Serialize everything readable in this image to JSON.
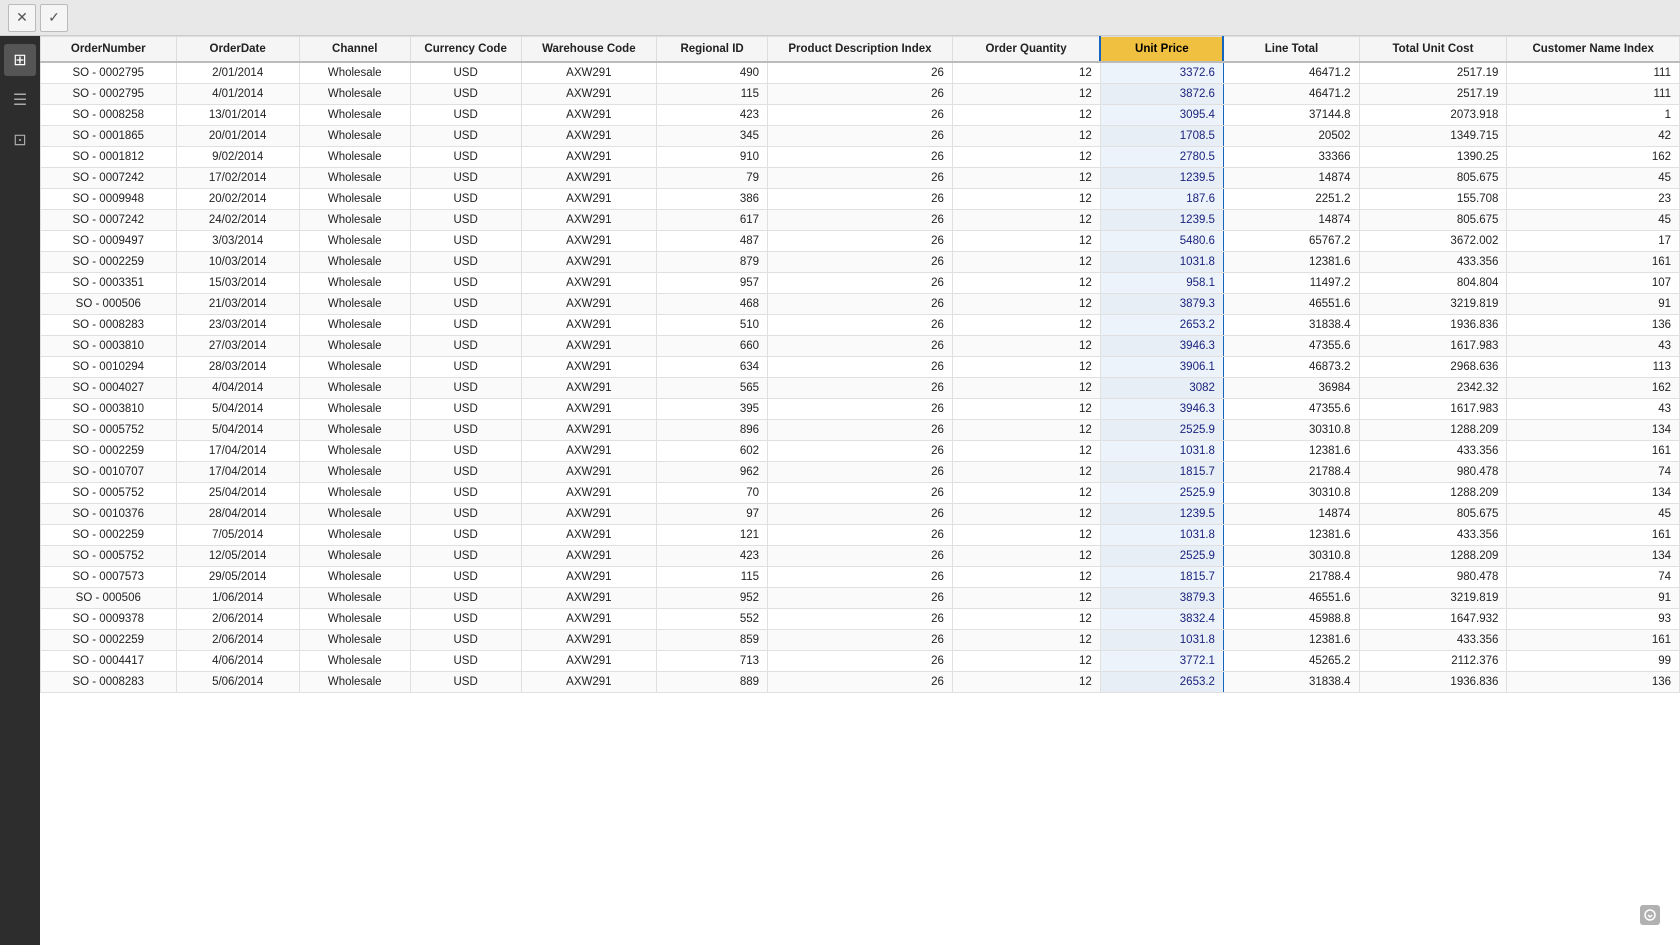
{
  "toolbar": {
    "close_label": "✕",
    "confirm_label": "✓"
  },
  "sidebar": {
    "items": [
      {
        "label": "⊞",
        "name": "grid-icon"
      },
      {
        "label": "≡",
        "name": "list-icon"
      },
      {
        "label": "⊡",
        "name": "table-icon"
      }
    ]
  },
  "table": {
    "columns": [
      {
        "key": "orderNumber",
        "label": "OrderNumber",
        "class": "col-order-number",
        "align": "text-col"
      },
      {
        "key": "orderDate",
        "label": "OrderDate",
        "class": "col-order-date",
        "align": "text-col"
      },
      {
        "key": "channel",
        "label": "Channel",
        "class": "col-channel",
        "align": "text-col"
      },
      {
        "key": "currencyCode",
        "label": "Currency Code",
        "class": "col-currency",
        "align": "text-col"
      },
      {
        "key": "warehouseCode",
        "label": "Warehouse Code",
        "class": "col-warehouse",
        "align": "text-col"
      },
      {
        "key": "regionalId",
        "label": "Regional ID",
        "class": "col-regional",
        "align": ""
      },
      {
        "key": "productDescIndex",
        "label": "Product Description Index",
        "class": "col-product-desc",
        "align": ""
      },
      {
        "key": "orderQuantity",
        "label": "Order Quantity",
        "class": "col-order-qty",
        "align": ""
      },
      {
        "key": "unitPrice",
        "label": "Unit Price",
        "class": "col-unit-price",
        "align": "",
        "sorted": true
      },
      {
        "key": "lineTotal",
        "label": "Line Total",
        "class": "col-line-total",
        "align": ""
      },
      {
        "key": "totalUnitCost",
        "label": "Total Unit Cost",
        "class": "col-total-unit",
        "align": ""
      },
      {
        "key": "customerNameIndex",
        "label": "Customer Name Index",
        "class": "col-customer",
        "align": ""
      }
    ],
    "rows": [
      {
        "orderNumber": "SO - 0002795",
        "orderDate": "2/01/2014",
        "channel": "Wholesale",
        "currencyCode": "USD",
        "warehouseCode": "AXW291",
        "regionalId": "490",
        "productDescIndex": "26",
        "orderQuantity": "12",
        "unitPrice": "3372.6",
        "lineTotal": "46471.2",
        "totalUnitCost": "2517.19",
        "customerNameIndex": "111"
      },
      {
        "orderNumber": "SO - 0002795",
        "orderDate": "4/01/2014",
        "channel": "Wholesale",
        "currencyCode": "USD",
        "warehouseCode": "AXW291",
        "regionalId": "115",
        "productDescIndex": "26",
        "orderQuantity": "12",
        "unitPrice": "3872.6",
        "lineTotal": "46471.2",
        "totalUnitCost": "2517.19",
        "customerNameIndex": "111"
      },
      {
        "orderNumber": "SO - 0008258",
        "orderDate": "13/01/2014",
        "channel": "Wholesale",
        "currencyCode": "USD",
        "warehouseCode": "AXW291",
        "regionalId": "423",
        "productDescIndex": "26",
        "orderQuantity": "12",
        "unitPrice": "3095.4",
        "lineTotal": "37144.8",
        "totalUnitCost": "2073.918",
        "customerNameIndex": "1"
      },
      {
        "orderNumber": "SO - 0001865",
        "orderDate": "20/01/2014",
        "channel": "Wholesale",
        "currencyCode": "USD",
        "warehouseCode": "AXW291",
        "regionalId": "345",
        "productDescIndex": "26",
        "orderQuantity": "12",
        "unitPrice": "1708.5",
        "lineTotal": "20502",
        "totalUnitCost": "1349.715",
        "customerNameIndex": "42"
      },
      {
        "orderNumber": "SO - 0001812",
        "orderDate": "9/02/2014",
        "channel": "Wholesale",
        "currencyCode": "USD",
        "warehouseCode": "AXW291",
        "regionalId": "910",
        "productDescIndex": "26",
        "orderQuantity": "12",
        "unitPrice": "2780.5",
        "lineTotal": "33366",
        "totalUnitCost": "1390.25",
        "customerNameIndex": "162"
      },
      {
        "orderNumber": "SO - 0007242",
        "orderDate": "17/02/2014",
        "channel": "Wholesale",
        "currencyCode": "USD",
        "warehouseCode": "AXW291",
        "regionalId": "79",
        "productDescIndex": "26",
        "orderQuantity": "12",
        "unitPrice": "1239.5",
        "lineTotal": "14874",
        "totalUnitCost": "805.675",
        "customerNameIndex": "45"
      },
      {
        "orderNumber": "SO - 0009948",
        "orderDate": "20/02/2014",
        "channel": "Wholesale",
        "currencyCode": "USD",
        "warehouseCode": "AXW291",
        "regionalId": "386",
        "productDescIndex": "26",
        "orderQuantity": "12",
        "unitPrice": "187.6",
        "lineTotal": "2251.2",
        "totalUnitCost": "155.708",
        "customerNameIndex": "23"
      },
      {
        "orderNumber": "SO - 0007242",
        "orderDate": "24/02/2014",
        "channel": "Wholesale",
        "currencyCode": "USD",
        "warehouseCode": "AXW291",
        "regionalId": "617",
        "productDescIndex": "26",
        "orderQuantity": "12",
        "unitPrice": "1239.5",
        "lineTotal": "14874",
        "totalUnitCost": "805.675",
        "customerNameIndex": "45"
      },
      {
        "orderNumber": "SO - 0009497",
        "orderDate": "3/03/2014",
        "channel": "Wholesale",
        "currencyCode": "USD",
        "warehouseCode": "AXW291",
        "regionalId": "487",
        "productDescIndex": "26",
        "orderQuantity": "12",
        "unitPrice": "5480.6",
        "lineTotal": "65767.2",
        "totalUnitCost": "3672.002",
        "customerNameIndex": "17"
      },
      {
        "orderNumber": "SO - 0002259",
        "orderDate": "10/03/2014",
        "channel": "Wholesale",
        "currencyCode": "USD",
        "warehouseCode": "AXW291",
        "regionalId": "879",
        "productDescIndex": "26",
        "orderQuantity": "12",
        "unitPrice": "1031.8",
        "lineTotal": "12381.6",
        "totalUnitCost": "433.356",
        "customerNameIndex": "161"
      },
      {
        "orderNumber": "SO - 0003351",
        "orderDate": "15/03/2014",
        "channel": "Wholesale",
        "currencyCode": "USD",
        "warehouseCode": "AXW291",
        "regionalId": "957",
        "productDescIndex": "26",
        "orderQuantity": "12",
        "unitPrice": "958.1",
        "lineTotal": "11497.2",
        "totalUnitCost": "804.804",
        "customerNameIndex": "107"
      },
      {
        "orderNumber": "SO - 000506",
        "orderDate": "21/03/2014",
        "channel": "Wholesale",
        "currencyCode": "USD",
        "warehouseCode": "AXW291",
        "regionalId": "468",
        "productDescIndex": "26",
        "orderQuantity": "12",
        "unitPrice": "3879.3",
        "lineTotal": "46551.6",
        "totalUnitCost": "3219.819",
        "customerNameIndex": "91"
      },
      {
        "orderNumber": "SO - 0008283",
        "orderDate": "23/03/2014",
        "channel": "Wholesale",
        "currencyCode": "USD",
        "warehouseCode": "AXW291",
        "regionalId": "510",
        "productDescIndex": "26",
        "orderQuantity": "12",
        "unitPrice": "2653.2",
        "lineTotal": "31838.4",
        "totalUnitCost": "1936.836",
        "customerNameIndex": "136"
      },
      {
        "orderNumber": "SO - 0003810",
        "orderDate": "27/03/2014",
        "channel": "Wholesale",
        "currencyCode": "USD",
        "warehouseCode": "AXW291",
        "regionalId": "660",
        "productDescIndex": "26",
        "orderQuantity": "12",
        "unitPrice": "3946.3",
        "lineTotal": "47355.6",
        "totalUnitCost": "1617.983",
        "customerNameIndex": "43"
      },
      {
        "orderNumber": "SO - 0010294",
        "orderDate": "28/03/2014",
        "channel": "Wholesale",
        "currencyCode": "USD",
        "warehouseCode": "AXW291",
        "regionalId": "634",
        "productDescIndex": "26",
        "orderQuantity": "12",
        "unitPrice": "3906.1",
        "lineTotal": "46873.2",
        "totalUnitCost": "2968.636",
        "customerNameIndex": "113"
      },
      {
        "orderNumber": "SO - 0004027",
        "orderDate": "4/04/2014",
        "channel": "Wholesale",
        "currencyCode": "USD",
        "warehouseCode": "AXW291",
        "regionalId": "565",
        "productDescIndex": "26",
        "orderQuantity": "12",
        "unitPrice": "3082",
        "lineTotal": "36984",
        "totalUnitCost": "2342.32",
        "customerNameIndex": "162"
      },
      {
        "orderNumber": "SO - 0003810",
        "orderDate": "5/04/2014",
        "channel": "Wholesale",
        "currencyCode": "USD",
        "warehouseCode": "AXW291",
        "regionalId": "395",
        "productDescIndex": "26",
        "orderQuantity": "12",
        "unitPrice": "3946.3",
        "lineTotal": "47355.6",
        "totalUnitCost": "1617.983",
        "customerNameIndex": "43"
      },
      {
        "orderNumber": "SO - 0005752",
        "orderDate": "5/04/2014",
        "channel": "Wholesale",
        "currencyCode": "USD",
        "warehouseCode": "AXW291",
        "regionalId": "896",
        "productDescIndex": "26",
        "orderQuantity": "12",
        "unitPrice": "2525.9",
        "lineTotal": "30310.8",
        "totalUnitCost": "1288.209",
        "customerNameIndex": "134"
      },
      {
        "orderNumber": "SO - 0002259",
        "orderDate": "17/04/2014",
        "channel": "Wholesale",
        "currencyCode": "USD",
        "warehouseCode": "AXW291",
        "regionalId": "602",
        "productDescIndex": "26",
        "orderQuantity": "12",
        "unitPrice": "1031.8",
        "lineTotal": "12381.6",
        "totalUnitCost": "433.356",
        "customerNameIndex": "161"
      },
      {
        "orderNumber": "SO - 0010707",
        "orderDate": "17/04/2014",
        "channel": "Wholesale",
        "currencyCode": "USD",
        "warehouseCode": "AXW291",
        "regionalId": "962",
        "productDescIndex": "26",
        "orderQuantity": "12",
        "unitPrice": "1815.7",
        "lineTotal": "21788.4",
        "totalUnitCost": "980.478",
        "customerNameIndex": "74"
      },
      {
        "orderNumber": "SO - 0005752",
        "orderDate": "25/04/2014",
        "channel": "Wholesale",
        "currencyCode": "USD",
        "warehouseCode": "AXW291",
        "regionalId": "70",
        "productDescIndex": "26",
        "orderQuantity": "12",
        "unitPrice": "2525.9",
        "lineTotal": "30310.8",
        "totalUnitCost": "1288.209",
        "customerNameIndex": "134"
      },
      {
        "orderNumber": "SO - 0010376",
        "orderDate": "28/04/2014",
        "channel": "Wholesale",
        "currencyCode": "USD",
        "warehouseCode": "AXW291",
        "regionalId": "97",
        "productDescIndex": "26",
        "orderQuantity": "12",
        "unitPrice": "1239.5",
        "lineTotal": "14874",
        "totalUnitCost": "805.675",
        "customerNameIndex": "45"
      },
      {
        "orderNumber": "SO - 0002259",
        "orderDate": "7/05/2014",
        "channel": "Wholesale",
        "currencyCode": "USD",
        "warehouseCode": "AXW291",
        "regionalId": "121",
        "productDescIndex": "26",
        "orderQuantity": "12",
        "unitPrice": "1031.8",
        "lineTotal": "12381.6",
        "totalUnitCost": "433.356",
        "customerNameIndex": "161"
      },
      {
        "orderNumber": "SO - 0005752",
        "orderDate": "12/05/2014",
        "channel": "Wholesale",
        "currencyCode": "USD",
        "warehouseCode": "AXW291",
        "regionalId": "423",
        "productDescIndex": "26",
        "orderQuantity": "12",
        "unitPrice": "2525.9",
        "lineTotal": "30310.8",
        "totalUnitCost": "1288.209",
        "customerNameIndex": "134"
      },
      {
        "orderNumber": "SO - 0007573",
        "orderDate": "29/05/2014",
        "channel": "Wholesale",
        "currencyCode": "USD",
        "warehouseCode": "AXW291",
        "regionalId": "115",
        "productDescIndex": "26",
        "orderQuantity": "12",
        "unitPrice": "1815.7",
        "lineTotal": "21788.4",
        "totalUnitCost": "980.478",
        "customerNameIndex": "74"
      },
      {
        "orderNumber": "SO - 000506",
        "orderDate": "1/06/2014",
        "channel": "Wholesale",
        "currencyCode": "USD",
        "warehouseCode": "AXW291",
        "regionalId": "952",
        "productDescIndex": "26",
        "orderQuantity": "12",
        "unitPrice": "3879.3",
        "lineTotal": "46551.6",
        "totalUnitCost": "3219.819",
        "customerNameIndex": "91"
      },
      {
        "orderNumber": "SO - 0009378",
        "orderDate": "2/06/2014",
        "channel": "Wholesale",
        "currencyCode": "USD",
        "warehouseCode": "AXW291",
        "regionalId": "552",
        "productDescIndex": "26",
        "orderQuantity": "12",
        "unitPrice": "3832.4",
        "lineTotal": "45988.8",
        "totalUnitCost": "1647.932",
        "customerNameIndex": "93"
      },
      {
        "orderNumber": "SO - 0002259",
        "orderDate": "2/06/2014",
        "channel": "Wholesale",
        "currencyCode": "USD",
        "warehouseCode": "AXW291",
        "regionalId": "859",
        "productDescIndex": "26",
        "orderQuantity": "12",
        "unitPrice": "1031.8",
        "lineTotal": "12381.6",
        "totalUnitCost": "433.356",
        "customerNameIndex": "161"
      },
      {
        "orderNumber": "SO - 0004417",
        "orderDate": "4/06/2014",
        "channel": "Wholesale",
        "currencyCode": "USD",
        "warehouseCode": "AXW291",
        "regionalId": "713",
        "productDescIndex": "26",
        "orderQuantity": "12",
        "unitPrice": "3772.1",
        "lineTotal": "45265.2",
        "totalUnitCost": "2112.376",
        "customerNameIndex": "99"
      },
      {
        "orderNumber": "SO - 0008283",
        "orderDate": "5/06/2014",
        "channel": "Wholesale",
        "currencyCode": "USD",
        "warehouseCode": "AXW291",
        "regionalId": "889",
        "productDescIndex": "26",
        "orderQuantity": "12",
        "unitPrice": "2653.2",
        "lineTotal": "31838.4",
        "totalUnitCost": "1936.836",
        "customerNameIndex": "136"
      }
    ]
  }
}
